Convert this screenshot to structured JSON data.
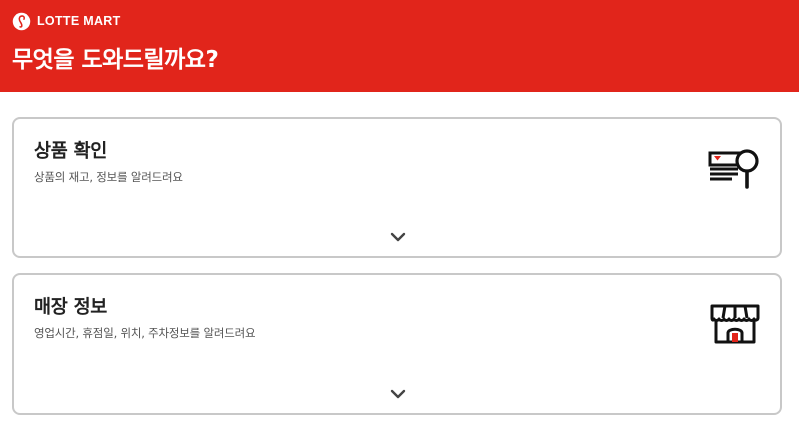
{
  "header": {
    "brand": "LOTTE MART",
    "title": "무엇을 도와드릴까요?",
    "background_color": "#e1251b"
  },
  "cards": [
    {
      "title": "상품 확인",
      "description": "상품의 재고, 정보를 알려드려요",
      "icon": "product-search-icon"
    },
    {
      "title": "매장 정보",
      "description": "영업시간, 휴점일, 위치, 주차정보를 알려드려요",
      "icon": "store-icon"
    }
  ],
  "chevron_icon": "chevron-down-icon"
}
